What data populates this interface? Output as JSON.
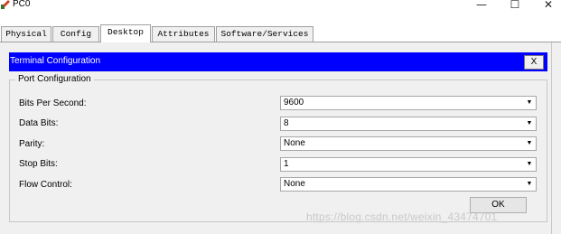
{
  "window": {
    "title": "PC0",
    "controls": {
      "minimize": "—",
      "maximize": "☐",
      "close": "✕"
    }
  },
  "tabs": [
    {
      "label": "Physical",
      "active": false
    },
    {
      "label": "Config",
      "active": false
    },
    {
      "label": "Desktop",
      "active": true
    },
    {
      "label": "Attributes",
      "active": false
    },
    {
      "label": "Software/Services",
      "active": false
    }
  ],
  "terminal": {
    "title": "Terminal Configuration",
    "close_label": "X",
    "header_color": "#0000ff",
    "group_label": "Port Configuration",
    "fields": [
      {
        "label": "Bits Per Second:",
        "value": "9600"
      },
      {
        "label": "Data Bits:",
        "value": "8"
      },
      {
        "label": "Parity:",
        "value": "None"
      },
      {
        "label": "Stop Bits:",
        "value": "1"
      },
      {
        "label": "Flow Control:",
        "value": "None"
      }
    ],
    "ok_label": "OK"
  },
  "watermark": "https://blog.csdn.net/weixin_43474701"
}
